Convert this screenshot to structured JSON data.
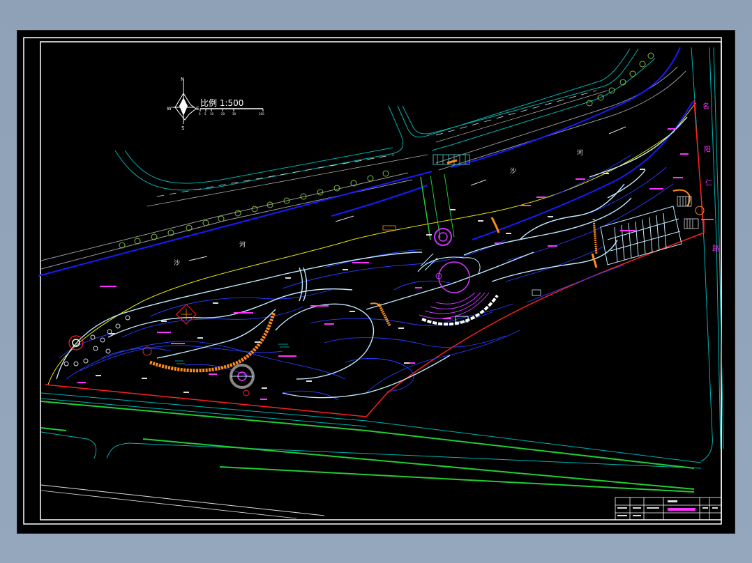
{
  "scale": {
    "label": "比例 1:500",
    "ticks": [
      "0",
      "5",
      "10",
      "20",
      "30",
      "100"
    ]
  },
  "compass": {
    "n": "N",
    "s": "S",
    "e": "E",
    "w": "W"
  },
  "river": {
    "sha": "沙",
    "he": "河"
  },
  "street": {
    "chars": [
      "名",
      "阳",
      "仁",
      "路"
    ]
  },
  "colors": {
    "background": "#000000",
    "frame": "#ffffff",
    "river_edge": "#1a1aff",
    "site_boundary": "#ff2020",
    "contour": "#2a3cff",
    "path": "#bfeaff",
    "road_line": "#00cccc",
    "green_strip": "#22cc33",
    "label_magenta": "#ff33ff",
    "plaza_magenta": "#cc33ff",
    "tree_green": "#7fbf3f",
    "pavement_orange": "#ff8c1a",
    "yellow_edge": "#ffff33"
  }
}
